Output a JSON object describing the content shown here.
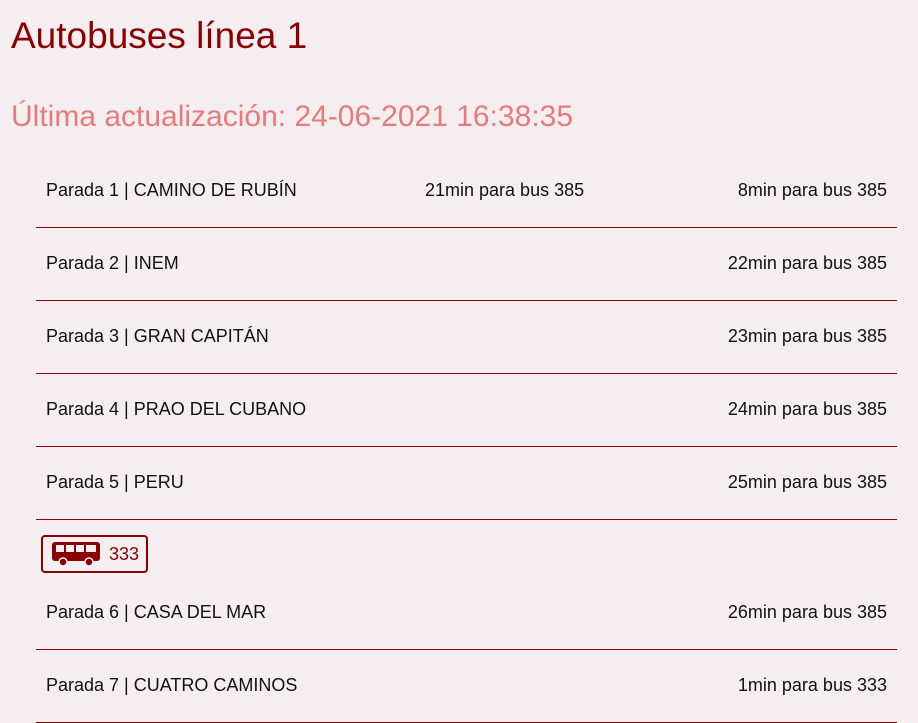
{
  "header": {
    "title": "Autobuses línea 1",
    "last_update": "Última actualización: 24-06-2021 16:38:35"
  },
  "stops": [
    {
      "name": "Parada 1 | CAMINO DE RUBÍN",
      "arrival_mid": "21min para bus 385",
      "arrival_right": "8min para bus 385"
    },
    {
      "name": "Parada 2 | INEM",
      "arrival_right": "22min para bus 385"
    },
    {
      "name": "Parada 3 | GRAN CAPITÁN",
      "arrival_right": "23min para bus 385"
    },
    {
      "name": "Parada 4 | PRAO DEL CUBANO",
      "arrival_right": "24min para bus 385"
    },
    {
      "name": "Parada 5 | PERU",
      "arrival_right": "25min para bus 385"
    },
    {
      "name": "Parada 6 | CASA DEL MAR",
      "arrival_right": "26min para bus 385"
    },
    {
      "name": "Parada 7 | CUATRO CAMINOS",
      "arrival_right": "1min para bus 333"
    }
  ],
  "bus_badge": {
    "icon": "bus-icon",
    "number": "333"
  },
  "colors": {
    "accent": "#8b0000",
    "update_text": "#e87a7a",
    "background": "#f5eef0"
  }
}
